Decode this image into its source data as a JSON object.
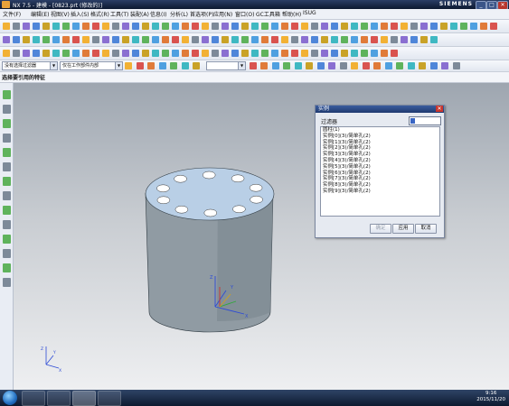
{
  "window": {
    "title": "NX 7.5 - 建模 - [0823.prt (修改的)]",
    "brand": "SIEMENS",
    "minimize_label": "_",
    "restore_label": "□",
    "close_label": "✕"
  },
  "menubar": {
    "items": [
      "文件(F)",
      "编辑(E)",
      "视图(V)",
      "插入(S)",
      "格式(R)",
      "工具(T)",
      "装配(A)",
      "信息(I)",
      "分析(L)",
      "首选项(P)",
      "应用(N)",
      "窗口(O)",
      "GC工具箱",
      "帮助(H)",
      "ISUG"
    ]
  },
  "selection_bar": {
    "filter_value": "没有选择过滤器",
    "scope_value": "仅在工作部件内部"
  },
  "prompt": "选择要引用的特征",
  "dialog": {
    "title": "实例",
    "close_label": "✕",
    "filter_label": "过滤器",
    "filter_value": "",
    "list_items": [
      "圆柱(1)",
      "实例[0](3)/简单孔(2)",
      "实例[1](3)/简单孔(2)",
      "实例[2](3)/简单孔(2)",
      "实例[3](3)/简单孔(2)",
      "实例[4](3)/简单孔(2)",
      "实例[5](3)/简单孔(2)",
      "实例[6](3)/简单孔(2)",
      "实例[7](3)/简单孔(2)",
      "实例[8](3)/简单孔(2)",
      "实例[9](3)/简单孔(2)"
    ],
    "buttons": {
      "ok": "确定",
      "apply": "应用",
      "cancel": "取消"
    }
  },
  "triad": {
    "z": "Z",
    "y": "Y",
    "x": "X"
  },
  "taskbar": {
    "time": "9:16",
    "date": "2015/11/20"
  },
  "colors": {
    "title_bar": "#1c2d52",
    "viewport_top": "#9ea6b0",
    "viewport_bottom": "#eeeff1",
    "cylinder_body": "#8f9ba2",
    "cylinder_top": "#b9cfe6",
    "dialog_title": "#2b4a88"
  }
}
